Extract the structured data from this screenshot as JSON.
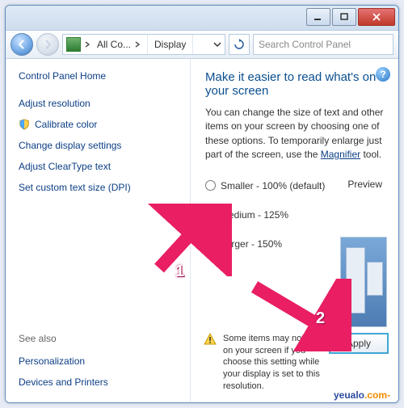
{
  "breadcrumb": {
    "seg1": "All Co...",
    "seg2": "Display"
  },
  "search": {
    "placeholder": "Search Control Panel"
  },
  "sidebar": {
    "home": "Control Panel Home",
    "items": [
      "Adjust resolution",
      "Calibrate color",
      "Change display settings",
      "Adjust ClearType text",
      "Set custom text size (DPI)"
    ],
    "see_also": "See also",
    "see_items": [
      "Personalization",
      "Devices and Printers"
    ]
  },
  "main": {
    "title": "Make it easier to read what's on your screen",
    "desc_before": "You can change the size of text and other items on your screen by choosing one of these options. To temporarily enlarge just part of the screen, use the ",
    "magnifier": "Magnifier",
    "desc_after": " tool.",
    "opt_small": "Smaller - 100% (default)",
    "opt_med": "Medium - 125%",
    "opt_large": "Larger - 150%",
    "preview": "Preview",
    "note": "Some items may not fit on your screen if you choose this setting while your display is set to this resolution.",
    "apply": "Apply"
  },
  "help": "?",
  "annotations": {
    "a1": "1",
    "a2": "2"
  },
  "watermark": {
    "a": "yeualo",
    "b": ".com-"
  }
}
